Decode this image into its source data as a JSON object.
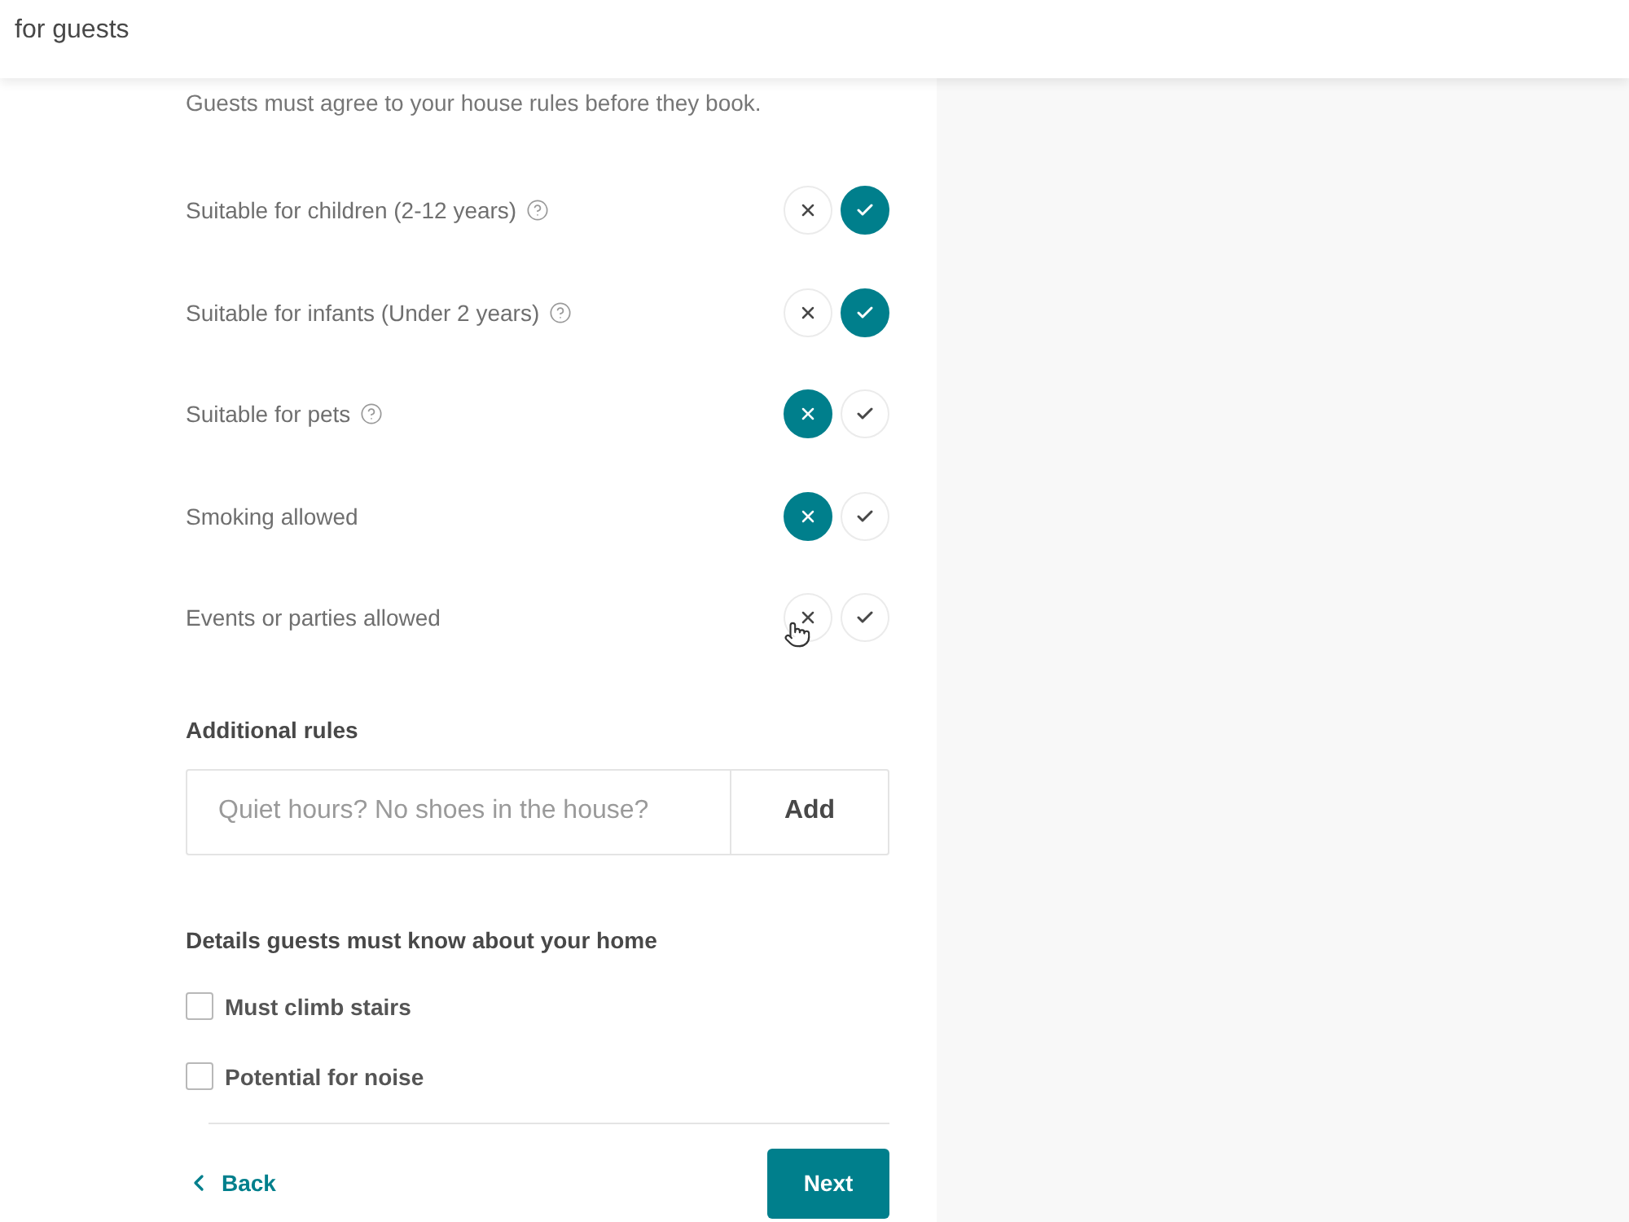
{
  "top_bar": {
    "title": "for guests"
  },
  "house_rules": {
    "subtitle": "Guests must agree to your house rules before they book.",
    "rules": [
      {
        "label": "Suitable for children (2-12 years)",
        "help": true,
        "options": [
          {
            "kind": "no",
            "selected": false
          },
          {
            "kind": "yes",
            "selected": true
          }
        ]
      },
      {
        "label": "Suitable for infants (Under 2 years)",
        "help": true,
        "options": [
          {
            "kind": "no",
            "selected": false
          },
          {
            "kind": "yes",
            "selected": true
          }
        ]
      },
      {
        "label": "Suitable for pets",
        "help": true,
        "options": [
          {
            "kind": "no",
            "selected": true
          },
          {
            "kind": "yes",
            "selected": false
          }
        ]
      },
      {
        "label": "Smoking allowed",
        "help": false,
        "options": [
          {
            "kind": "no",
            "selected": true
          },
          {
            "kind": "yes",
            "selected": false
          }
        ]
      },
      {
        "label": "Events or parties allowed",
        "help": false,
        "options": [
          {
            "kind": "no",
            "selected": false
          },
          {
            "kind": "yes",
            "selected": false
          }
        ]
      }
    ]
  },
  "additional_rules": {
    "heading": "Additional rules",
    "input": {
      "placeholder": "Quiet hours? No shoes in the house?"
    },
    "button": "Add"
  },
  "details": {
    "heading": "Details guests must know about your home",
    "items": [
      {
        "label": "Must climb stairs",
        "checked": false
      },
      {
        "label": "Potential for noise",
        "checked": false
      }
    ]
  },
  "footer": {
    "back": "Back",
    "next": "Next"
  }
}
